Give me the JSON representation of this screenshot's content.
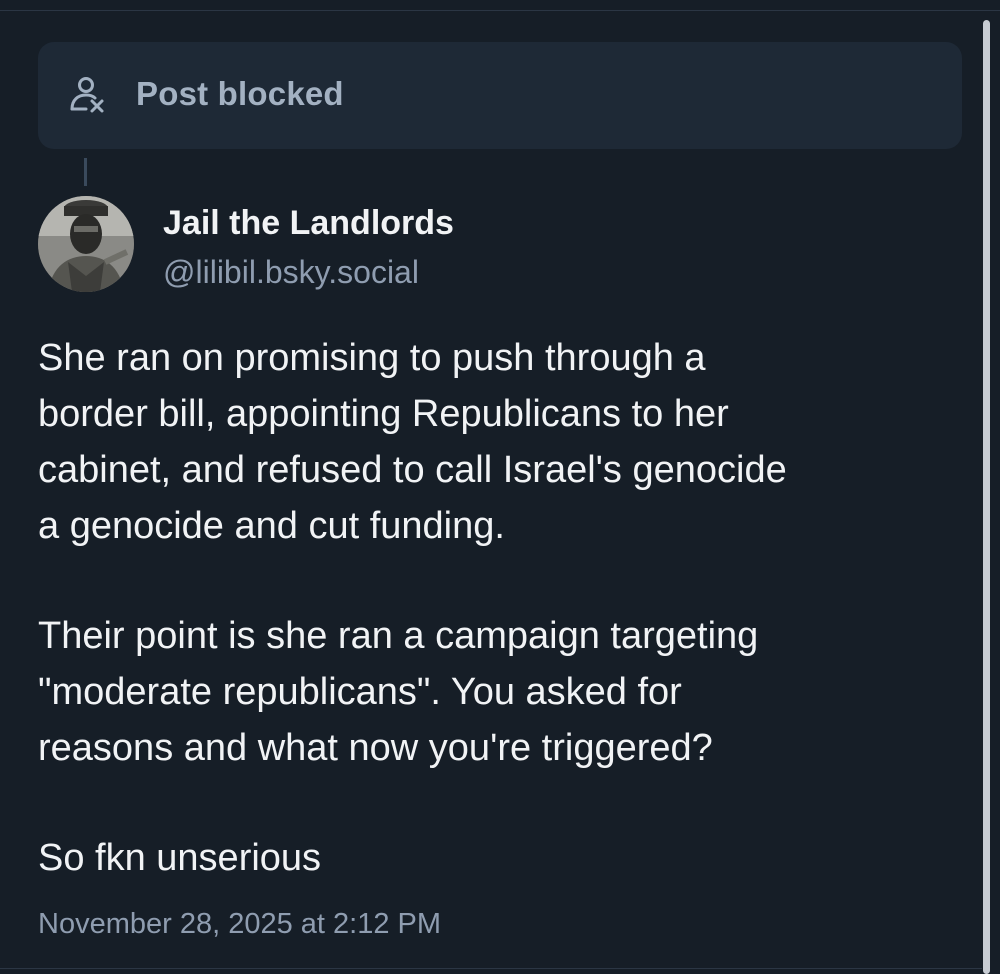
{
  "blocked_notice": {
    "label": "Post blocked",
    "icon": "person-x-icon"
  },
  "post": {
    "author": {
      "display_name": "Jail the Landlords",
      "handle": "@lilibil.bsky.social"
    },
    "paragraphs": [
      "She ran on promising to push through a\nborder bill, appointing Republicans to her\ncabinet, and refused to call Israel's genocide\na genocide and cut funding.",
      "Their point is she ran a campaign targeting\n\"moderate republicans\". You asked for\nreasons and what now you're triggered?",
      "So fkn unserious"
    ],
    "timestamp": "November 28, 2025 at 2:12 PM"
  },
  "colors": {
    "background": "#161e27",
    "blocked_box": "#1e2936",
    "muted_text": "#8f9db0",
    "primary_text": "#f1f3f5"
  }
}
